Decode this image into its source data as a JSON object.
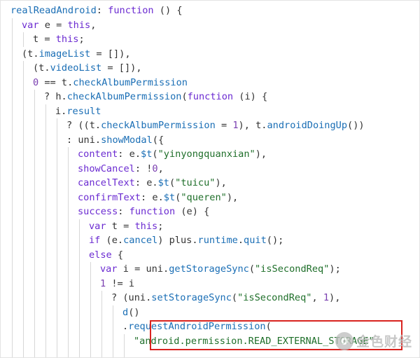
{
  "colors": {
    "text": "#333333",
    "keyword": "#6b2bd1",
    "property": "#1a6eb5",
    "string": "#1f6f2a",
    "number": "#7a3fb0",
    "highlight_border": "#d9231f",
    "guide": "#d7d7d7"
  },
  "code_lines": [
    {
      "indent": 0,
      "tokens": [
        {
          "t": "realReadAndroid",
          "c": "property"
        },
        {
          "t": ": ",
          "c": "text"
        },
        {
          "t": "function",
          "c": "keyword"
        },
        {
          "t": " () {",
          "c": "text"
        }
      ]
    },
    {
      "indent": 1,
      "tokens": [
        {
          "t": "var",
          "c": "keyword"
        },
        {
          "t": " e = ",
          "c": "text"
        },
        {
          "t": "this",
          "c": "keyword"
        },
        {
          "t": ",",
          "c": "text"
        }
      ]
    },
    {
      "indent": 2,
      "tokens": [
        {
          "t": "t = ",
          "c": "text"
        },
        {
          "t": "this",
          "c": "keyword"
        },
        {
          "t": ";",
          "c": "text"
        }
      ]
    },
    {
      "indent": 1,
      "tokens": [
        {
          "t": "(t.",
          "c": "text"
        },
        {
          "t": "imageList",
          "c": "property"
        },
        {
          "t": " = []),",
          "c": "text"
        }
      ]
    },
    {
      "indent": 2,
      "tokens": [
        {
          "t": "(t.",
          "c": "text"
        },
        {
          "t": "videoList",
          "c": "property"
        },
        {
          "t": " = []),",
          "c": "text"
        }
      ]
    },
    {
      "indent": 2,
      "tokens": [
        {
          "t": "0",
          "c": "number"
        },
        {
          "t": " == t.",
          "c": "text"
        },
        {
          "t": "checkAlbumPermission",
          "c": "property"
        }
      ]
    },
    {
      "indent": 3,
      "tokens": [
        {
          "t": "? h.",
          "c": "text"
        },
        {
          "t": "checkAlbumPermission",
          "c": "property"
        },
        {
          "t": "(",
          "c": "text"
        },
        {
          "t": "function",
          "c": "keyword"
        },
        {
          "t": " (i) {",
          "c": "text"
        }
      ]
    },
    {
      "indent": 4,
      "tokens": [
        {
          "t": "i.",
          "c": "text"
        },
        {
          "t": "result",
          "c": "property"
        }
      ]
    },
    {
      "indent": 5,
      "tokens": [
        {
          "t": "? ((t.",
          "c": "text"
        },
        {
          "t": "checkAlbumPermission",
          "c": "property"
        },
        {
          "t": " = ",
          "c": "text"
        },
        {
          "t": "1",
          "c": "number"
        },
        {
          "t": "), t.",
          "c": "text"
        },
        {
          "t": "androidDoingUp",
          "c": "property"
        },
        {
          "t": "())",
          "c": "text"
        }
      ]
    },
    {
      "indent": 5,
      "tokens": [
        {
          "t": ": uni.",
          "c": "text"
        },
        {
          "t": "showModal",
          "c": "property"
        },
        {
          "t": "({",
          "c": "text"
        }
      ]
    },
    {
      "indent": 6,
      "tokens": [
        {
          "t": "content",
          "c": "keyword"
        },
        {
          "t": ": e.",
          "c": "text"
        },
        {
          "t": "$t",
          "c": "property"
        },
        {
          "t": "(",
          "c": "text"
        },
        {
          "t": "\"yinyongquanxian\"",
          "c": "string"
        },
        {
          "t": "),",
          "c": "text"
        }
      ]
    },
    {
      "indent": 6,
      "tokens": [
        {
          "t": "showCancel",
          "c": "keyword"
        },
        {
          "t": ": !",
          "c": "text"
        },
        {
          "t": "0",
          "c": "number"
        },
        {
          "t": ",",
          "c": "text"
        }
      ]
    },
    {
      "indent": 6,
      "tokens": [
        {
          "t": "cancelText",
          "c": "keyword"
        },
        {
          "t": ": e.",
          "c": "text"
        },
        {
          "t": "$t",
          "c": "property"
        },
        {
          "t": "(",
          "c": "text"
        },
        {
          "t": "\"tuicu\"",
          "c": "string"
        },
        {
          "t": "),",
          "c": "text"
        }
      ]
    },
    {
      "indent": 6,
      "tokens": [
        {
          "t": "confirmText",
          "c": "keyword"
        },
        {
          "t": ": e.",
          "c": "text"
        },
        {
          "t": "$t",
          "c": "property"
        },
        {
          "t": "(",
          "c": "text"
        },
        {
          "t": "\"queren\"",
          "c": "string"
        },
        {
          "t": "),",
          "c": "text"
        }
      ]
    },
    {
      "indent": 6,
      "tokens": [
        {
          "t": "success",
          "c": "keyword"
        },
        {
          "t": ": ",
          "c": "text"
        },
        {
          "t": "function",
          "c": "keyword"
        },
        {
          "t": " (e) {",
          "c": "text"
        }
      ]
    },
    {
      "indent": 7,
      "tokens": [
        {
          "t": "var",
          "c": "keyword"
        },
        {
          "t": " t = ",
          "c": "text"
        },
        {
          "t": "this",
          "c": "keyword"
        },
        {
          "t": ";",
          "c": "text"
        }
      ]
    },
    {
      "indent": 7,
      "tokens": [
        {
          "t": "if",
          "c": "keyword"
        },
        {
          "t": " (e.",
          "c": "text"
        },
        {
          "t": "cancel",
          "c": "property"
        },
        {
          "t": ") plus.",
          "c": "text"
        },
        {
          "t": "runtime",
          "c": "property"
        },
        {
          "t": ".",
          "c": "text"
        },
        {
          "t": "quit",
          "c": "property"
        },
        {
          "t": "();",
          "c": "text"
        }
      ]
    },
    {
      "indent": 7,
      "tokens": [
        {
          "t": "else",
          "c": "keyword"
        },
        {
          "t": " {",
          "c": "text"
        }
      ]
    },
    {
      "indent": 8,
      "tokens": [
        {
          "t": "var",
          "c": "keyword"
        },
        {
          "t": " i = uni.",
          "c": "text"
        },
        {
          "t": "getStorageSync",
          "c": "property"
        },
        {
          "t": "(",
          "c": "text"
        },
        {
          "t": "\"isSecondReq\"",
          "c": "string"
        },
        {
          "t": ");",
          "c": "text"
        }
      ]
    },
    {
      "indent": 8,
      "tokens": [
        {
          "t": "1",
          "c": "number"
        },
        {
          "t": " != i",
          "c": "text"
        }
      ]
    },
    {
      "indent": 9,
      "tokens": [
        {
          "t": "? (uni.",
          "c": "text"
        },
        {
          "t": "setStorageSync",
          "c": "property"
        },
        {
          "t": "(",
          "c": "text"
        },
        {
          "t": "\"isSecondReq\"",
          "c": "string"
        },
        {
          "t": ", ",
          "c": "text"
        },
        {
          "t": "1",
          "c": "number"
        },
        {
          "t": "),",
          "c": "text"
        }
      ]
    },
    {
      "indent": 10,
      "tokens": [
        {
          "t": "d",
          "c": "property"
        },
        {
          "t": "()",
          "c": "text"
        }
      ]
    },
    {
      "indent": 10,
      "tokens": [
        {
          "t": ".",
          "c": "text"
        },
        {
          "t": "requestAndroidPermission",
          "c": "property"
        },
        {
          "t": "(",
          "c": "text"
        }
      ]
    },
    {
      "indent": 11,
      "tokens": [
        {
          "t": "\"android.permission.READ_EXTERNAL_STORAGE\"",
          "c": "string"
        }
      ]
    }
  ],
  "watermark": {
    "text": "金色财经",
    "icon": "golden-finance-logo"
  }
}
